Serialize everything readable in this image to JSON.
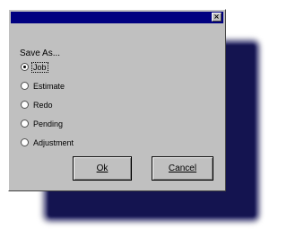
{
  "colors": {
    "titlebar": "#000080",
    "dialog_face": "#c0c0c0",
    "backdrop_window": "#141450"
  },
  "dialog": {
    "title": "",
    "close_glyph": "×",
    "caption": "Save As...",
    "options": [
      {
        "label": "Job",
        "checked": true
      },
      {
        "label": "Estimate",
        "checked": false
      },
      {
        "label": "Redo",
        "checked": false
      },
      {
        "label": "Pending",
        "checked": false
      },
      {
        "label": "Adjustment",
        "checked": false
      }
    ],
    "ok_label": "Ok",
    "cancel_label": "Cancel"
  }
}
